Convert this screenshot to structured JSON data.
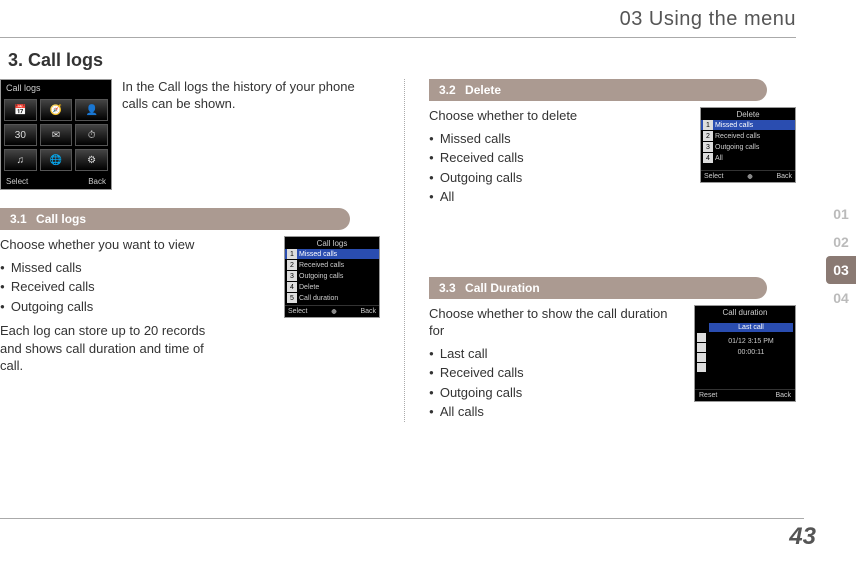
{
  "header": {
    "title": "03 Using the menu"
  },
  "section": {
    "title": "3. Call logs"
  },
  "intro": "In the Call logs the history of your phone calls can be shown.",
  "sub31": {
    "num": "3.1",
    "label": "Call logs",
    "lead": "Choose whether you want to view",
    "items": [
      "Missed calls",
      "Received calls",
      "Outgoing calls"
    ],
    "after": "Each log can store up to 20 records and shows call duration and time of call."
  },
  "sub32": {
    "num": "3.2",
    "label": "Delete",
    "lead": "Choose whether to delete",
    "items": [
      "Missed calls",
      "Received calls",
      "Outgoing calls",
      "All"
    ]
  },
  "sub33": {
    "num": "3.3",
    "label": "Call Duration",
    "lead": "Choose whether to show the call duration for",
    "items": [
      "Last call",
      "Received calls",
      "Outgoing calls",
      "All calls"
    ]
  },
  "tabs": [
    "01",
    "02",
    "03",
    "04"
  ],
  "tabActive": "03",
  "pageNumber": "43",
  "phoneIcons": {
    "title": "Call logs",
    "softLeft": "Select",
    "softRight": "Back",
    "glyphs": [
      "📅",
      "🧭",
      "👤",
      "30",
      "✉",
      "⏱",
      "♫",
      "🌐",
      "⚙"
    ]
  },
  "phoneCallLogs": {
    "title": "Call logs",
    "rows": [
      "Missed calls",
      "Received calls",
      "Outgoing calls",
      "Delete",
      "Call duration"
    ],
    "nums": [
      "1",
      "2",
      "3",
      "4",
      "5"
    ],
    "softLeft": "Select",
    "softRight": "Back"
  },
  "phoneDelete": {
    "title": "Delete",
    "rows": [
      "Missed calls",
      "Received calls",
      "Outgoing calls",
      "All"
    ],
    "nums": [
      "1",
      "2",
      "3",
      "4"
    ],
    "softLeft": "Select",
    "softRight": "Back"
  },
  "phoneDuration": {
    "title": "Call duration",
    "highlight": "Last call",
    "line1": "01/12 3:15 PM",
    "line2": "00:00:11",
    "softLeft": "Reset",
    "softRight": "Back"
  }
}
